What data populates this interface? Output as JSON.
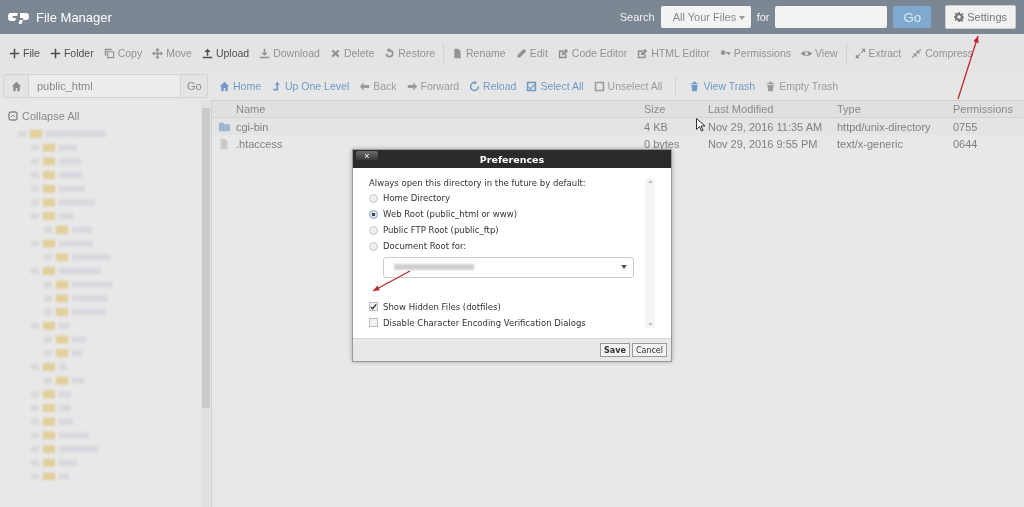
{
  "header": {
    "title": "File Manager",
    "search_label": "Search",
    "scope": "All Your Files",
    "for_label": "for",
    "go": "Go",
    "settings": "Settings"
  },
  "toolbar": {
    "groups": [
      [
        {
          "label": "File",
          "disabled": false
        },
        {
          "label": "Folder",
          "disabled": false
        },
        {
          "label": "Copy",
          "disabled": true
        },
        {
          "label": "Move",
          "disabled": true
        },
        {
          "label": "Upload",
          "disabled": false
        },
        {
          "label": "Download",
          "disabled": true
        },
        {
          "label": "Delete",
          "disabled": true
        },
        {
          "label": "Restore",
          "disabled": true
        }
      ],
      [
        {
          "label": "Rename",
          "disabled": true
        },
        {
          "label": "Edit",
          "disabled": true
        },
        {
          "label": "Code Editor",
          "disabled": true
        },
        {
          "label": "HTML Editor",
          "disabled": true
        },
        {
          "label": "Permissions",
          "disabled": true
        },
        {
          "label": "View",
          "disabled": true
        }
      ],
      [
        {
          "label": "Extract",
          "disabled": true
        },
        {
          "label": "Compress",
          "disabled": true
        }
      ]
    ]
  },
  "path_bar": {
    "value": "public_html",
    "go": "Go"
  },
  "nav": {
    "groups": [
      [
        {
          "label": "Home",
          "disabled": false
        },
        {
          "label": "Up One Level",
          "disabled": false
        },
        {
          "label": "Back",
          "disabled": true
        },
        {
          "label": "Forward",
          "disabled": true
        },
        {
          "label": "Reload",
          "disabled": false
        },
        {
          "label": "Select All",
          "disabled": false
        },
        {
          "label": "Unselect All",
          "disabled": true
        }
      ],
      [
        {
          "label": "View Trash",
          "disabled": false
        },
        {
          "label": "Empty Trash",
          "disabled": true
        }
      ]
    ]
  },
  "tree": {
    "collapse_all": "Collapse All"
  },
  "table": {
    "columns": [
      "Name",
      "Size",
      "Last Modified",
      "Type",
      "Permissions"
    ],
    "rows": [
      {
        "kind": "folder",
        "name": "cgi-bin",
        "size": "4 KB",
        "modified": "Nov 29, 2016 11:35 AM",
        "type": "httpd/unix-directory",
        "permissions": "0755"
      },
      {
        "kind": "file",
        "name": ".htaccess",
        "size": "0 bytes",
        "modified": "Nov 29, 2016 9:55 PM",
        "type": "text/x-generic",
        "permissions": "0644"
      }
    ]
  },
  "dialog": {
    "title": "Preferences",
    "close": "×",
    "prompt": "Always open this directory in the future by default:",
    "options": [
      {
        "kind": "radio",
        "label": "Home Directory",
        "selected": false
      },
      {
        "kind": "radio",
        "label": "Web Root (public_html or www)",
        "selected": true
      },
      {
        "kind": "radio",
        "label": "Public FTP Root (public_ftp)",
        "selected": false
      },
      {
        "kind": "radio",
        "label": "Document Root for:",
        "selected": false
      },
      {
        "kind": "select"
      },
      {
        "kind": "checkbox",
        "label": "Show Hidden Files (dotfiles)",
        "checked": true
      },
      {
        "kind": "checkbox",
        "label": "Disable Character Encoding Verification Dialogs",
        "checked": false
      }
    ],
    "buttons": [
      "Save",
      "Cancel"
    ]
  }
}
